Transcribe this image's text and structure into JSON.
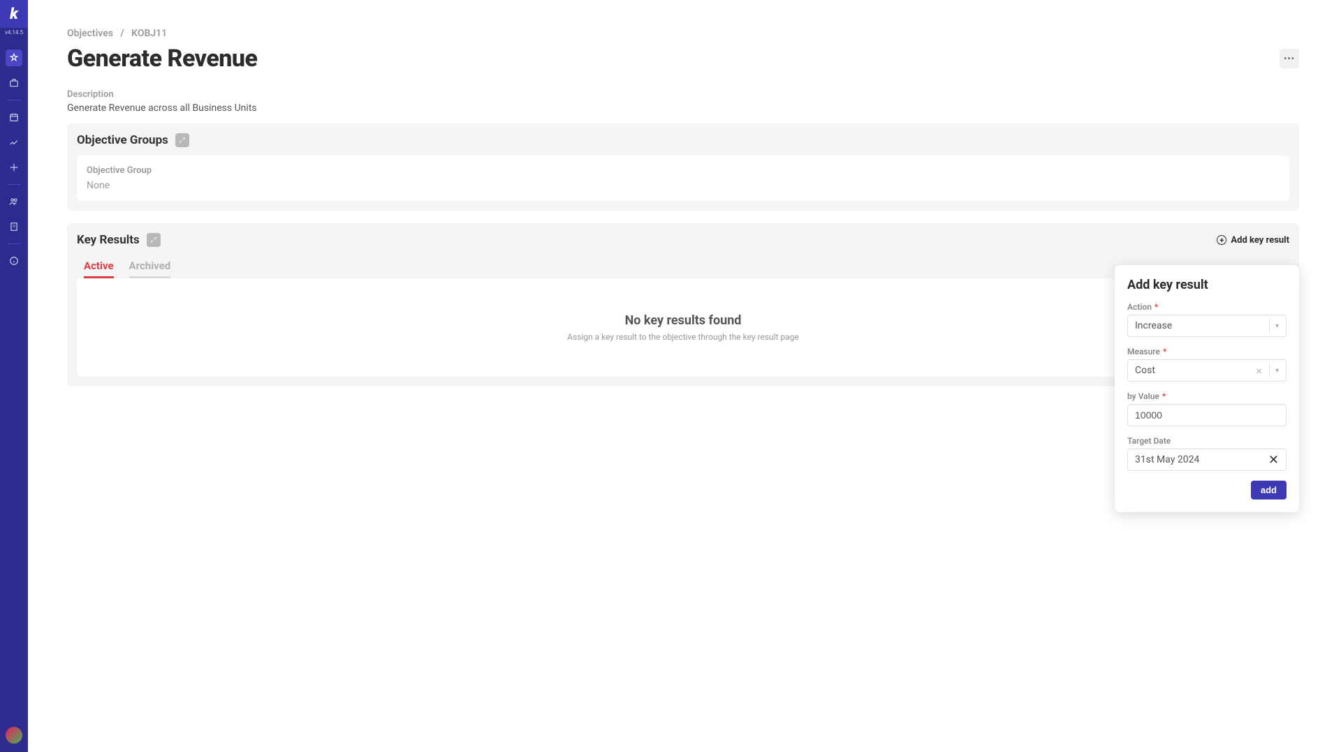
{
  "sidebar": {
    "logo": "k",
    "version": "v4.14.5"
  },
  "breadcrumb": {
    "parent": "Objectives",
    "sep": "/",
    "current": "KOBJ11"
  },
  "page": {
    "title": "Generate Revenue",
    "desc_label": "Description",
    "desc_text": "Generate Revenue across all Business Units"
  },
  "objective_groups": {
    "title": "Objective Groups",
    "card_label": "Objective Group",
    "card_value": "None"
  },
  "key_results": {
    "title": "Key Results",
    "add_link": "Add key result",
    "tabs": {
      "active": "Active",
      "archived": "Archived"
    },
    "empty_title": "No key results found",
    "empty_sub": "Assign a key result to the objective through the key result page"
  },
  "popover": {
    "title": "Add key result",
    "action_label": "Action",
    "action_value": "Increase",
    "measure_label": "Measure",
    "measure_value": "Cost",
    "byvalue_label": "by Value",
    "byvalue_value": "10000",
    "targetdate_label": "Target Date",
    "targetdate_value": "31st May 2024",
    "add_button": "add"
  }
}
